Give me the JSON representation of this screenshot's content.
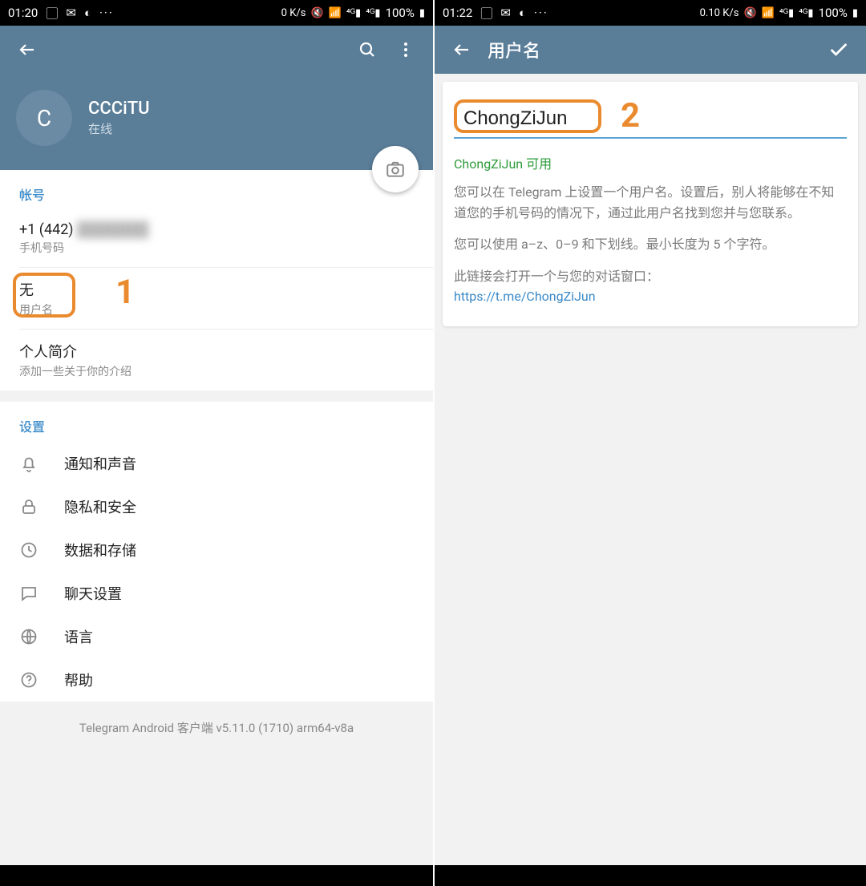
{
  "left": {
    "status": {
      "time": "01:20",
      "net": "0 K/s",
      "battery": "100%"
    },
    "profile": {
      "initial": "C",
      "name": "CCCiTU",
      "status": "在线"
    },
    "account": {
      "header": "帐号",
      "phone_value": "+1 (442)",
      "phone_hidden": "███████",
      "phone_label": "手机号码",
      "username_value": "无",
      "username_label": "用户名",
      "bio_value": "个人简介",
      "bio_label": "添加一些关于你的介绍"
    },
    "settings": {
      "header": "设置",
      "items": [
        {
          "label": "通知和声音"
        },
        {
          "label": "隐私和安全"
        },
        {
          "label": "数据和存储"
        },
        {
          "label": "聊天设置"
        },
        {
          "label": "语言"
        },
        {
          "label": "帮助"
        }
      ]
    },
    "version": "Telegram Android 客户端 v5.11.0 (1710) arm64-v8a",
    "annot": "1"
  },
  "right": {
    "status": {
      "time": "01:22",
      "net": "0.10 K/s",
      "battery": "100%"
    },
    "title": "用户名",
    "input_value": "ChongZiJun",
    "annot": "2",
    "available": "ChongZiJun 可用",
    "help1": "您可以在 Telegram 上设置一个用户名。设置后，别人将能够在不知道您的手机号码的情况下，通过此用户名找到您并与您联系。",
    "help2": "您可以使用 a–z、0–9 和下划线。最小长度为 5 个字符。",
    "help3": "此链接会打开一个与您的对话窗口：",
    "link": "https://t.me/ChongZiJun"
  }
}
